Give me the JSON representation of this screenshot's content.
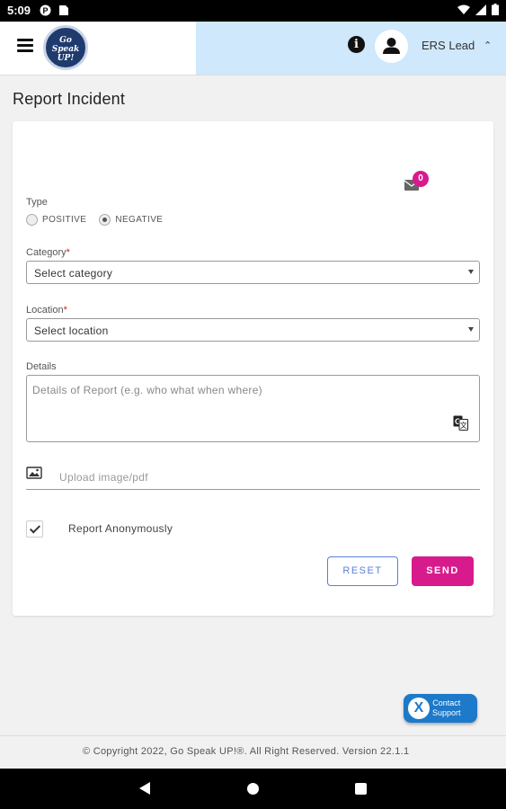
{
  "status_bar": {
    "time": "5:09",
    "icons": [
      "p-badge-icon",
      "sd-card-icon",
      "wifi-icon",
      "signal-icon",
      "battery-icon"
    ]
  },
  "header": {
    "logo_text": "Go Speak UP!",
    "user_name": "ERS Lead",
    "icons": [
      "menu-icon",
      "info-icon",
      "user-icon",
      "chevron-up-icon"
    ],
    "accent_color": "#cfe8fb"
  },
  "page": {
    "title": "Report Incident"
  },
  "form": {
    "mail_count": "0",
    "type": {
      "label": "Type",
      "options": [
        "POSITIVE",
        "NEGATIVE"
      ],
      "selected": "NEGATIVE"
    },
    "category": {
      "label": "Category",
      "required_mark": "*",
      "value": "Select category"
    },
    "location": {
      "label": "Location",
      "required_mark": "*",
      "value": "Select location"
    },
    "details": {
      "label": "Details",
      "placeholder": "Details of Report (e.g. who what when where)"
    },
    "upload": {
      "placeholder": "Upload image/pdf"
    },
    "anonymous": {
      "label": "Report Anonymously",
      "checked": true
    },
    "buttons": {
      "reset": "RESET",
      "send": "SEND"
    },
    "colors": {
      "primary": "#d81b8c",
      "secondary": "#5b7fd8"
    }
  },
  "contact_support": {
    "line1": "Contact",
    "line2": "Support",
    "logo_glyph": "X",
    "color": "#1d79c9"
  },
  "footer": {
    "text": "© Copyright 2022, Go Speak UP!®.    All Right Reserved. Version 22.1.1"
  }
}
